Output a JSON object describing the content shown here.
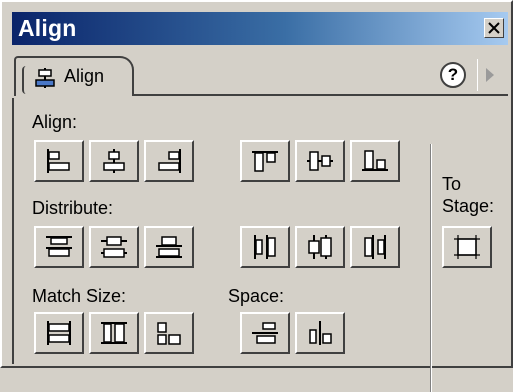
{
  "window": {
    "title": "Align",
    "close_icon": "close-icon"
  },
  "tab": {
    "label": "Align",
    "icon": "align-panel-icon",
    "help_label": "?",
    "menu_icon": "panel-menu-arrow-icon"
  },
  "sections": {
    "align_label": "Align:",
    "distribute_label": "Distribute:",
    "match_size_label": "Match Size:",
    "space_label": "Space:",
    "to_stage_label_line1": "To",
    "to_stage_label_line2": "Stage:"
  },
  "buttons": {
    "align": [
      "align-left-edge-icon",
      "align-horizontal-center-icon",
      "align-right-edge-icon",
      "align-top-edge-icon",
      "align-vertical-center-icon",
      "align-bottom-edge-icon"
    ],
    "distribute": [
      "distribute-top-edge-icon",
      "distribute-vertical-center-icon",
      "distribute-bottom-edge-icon",
      "distribute-left-edge-icon",
      "distribute-horizontal-center-icon",
      "distribute-right-edge-icon"
    ],
    "match_size": [
      "match-width-icon",
      "match-height-icon",
      "match-width-and-height-icon"
    ],
    "space": [
      "space-evenly-vertically-icon",
      "space-evenly-horizontally-icon"
    ],
    "to_stage": "to-stage-icon"
  }
}
